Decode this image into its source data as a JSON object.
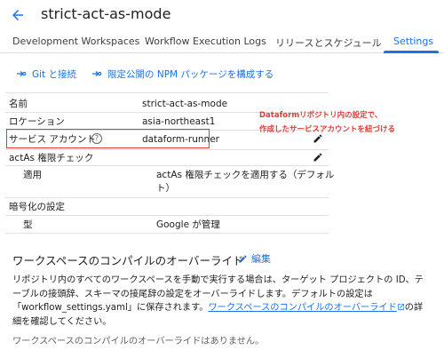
{
  "header": {
    "title": "strict-act-as-mode",
    "back_icon": "arrow-back-icon"
  },
  "tabs": [
    {
      "label": "Development Workspaces",
      "active": false
    },
    {
      "label": "Workflow Execution Logs",
      "active": false
    },
    {
      "label": "リリースとスケジュール",
      "active": false
    },
    {
      "label": "Settings",
      "active": true
    }
  ],
  "actions": {
    "git_connect": "Git と接続",
    "npm_package": "限定公開の NPM パッケージを構成する"
  },
  "settings": {
    "name_label": "名前",
    "name_value": "strict-act-as-mode",
    "location_label": "ロケーション",
    "location_value": "asia-northeast1",
    "service_account_label": "サービス アカウント",
    "service_account_value": "dataform-runner",
    "actas_label": "actAs 権限チェック",
    "actas_applied_label": "適用",
    "actas_applied_value_line1": "actAs 権限チェックを適用する（デフォル",
    "actas_applied_value_line2": "ト）",
    "encryption_label": "暗号化の設定",
    "encryption_type_label": "型",
    "encryption_type_value": "Google が管理"
  },
  "annotation": {
    "line1": "Dataformリポジトリ内の設定で、",
    "line2": "作成したサービスアカウントを紐づける"
  },
  "compile_override": {
    "title": "ワークスペースのコンパイルのオーバーライド",
    "edit_label": "編集",
    "description_part1": "リポジトリ内のすべてのワークスペースを手動で実行する場合は、ターゲット プロジェクトの ID、テーブルの接頭辞、スキーマの接尾辞の設定をオーバーライドします。デフォルトの設定は「workflow_settings.yaml」に保存されます。",
    "link_text": "ワークスペースのコンパイルのオーバーライド",
    "description_part2": "の詳細を確認してください。",
    "no_override": "ワークスペースのコンパイルのオーバーライドはありません。"
  },
  "colors": {
    "accent": "#1a73e8",
    "annotation": "#e53935",
    "divider": "#e0e0e0"
  }
}
